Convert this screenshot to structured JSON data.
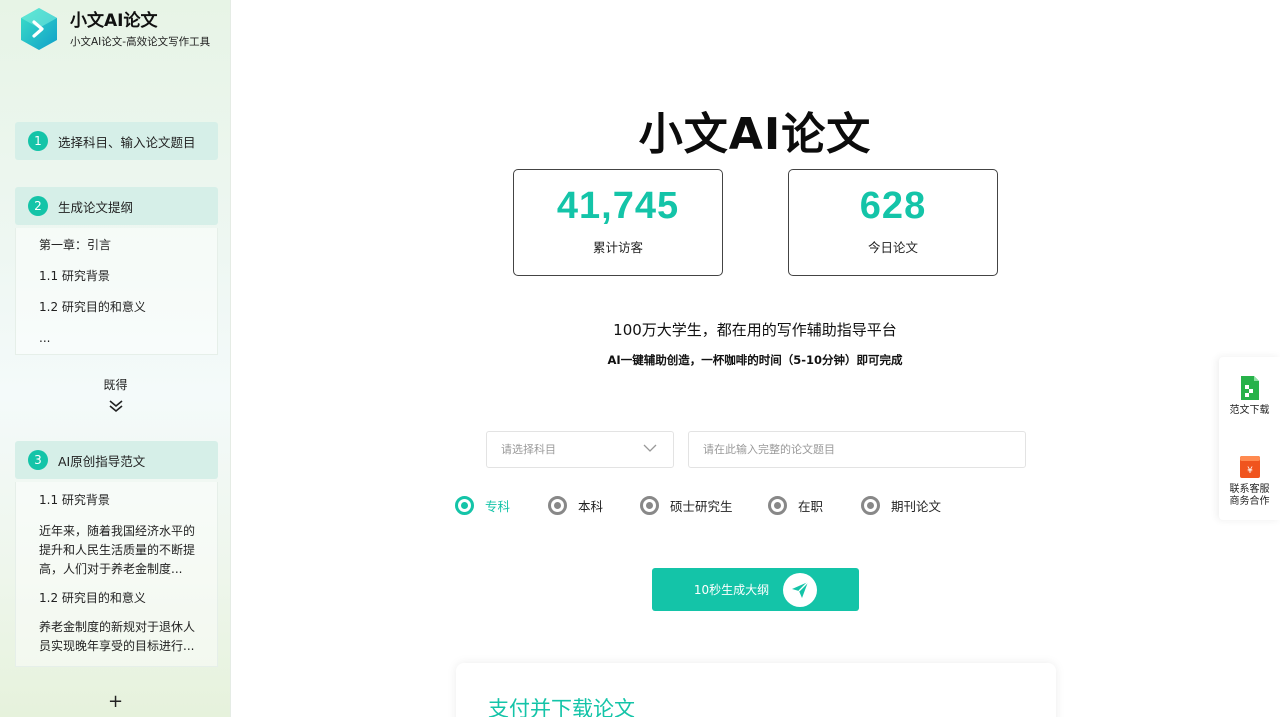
{
  "sidebar": {
    "brand_title": "小文AI论文",
    "brand_subtitle": "小文AI论文-高效论文写作工具",
    "steps": [
      {
        "num": "1",
        "label": "选择科目、输入论文题目"
      },
      {
        "num": "2",
        "label": "生成论文提纲"
      },
      {
        "num": "3",
        "label": "AI原创指导范文"
      }
    ],
    "outline_items": [
      "第一章：引言",
      "1.1 研究背景",
      "1.2 研究目的和意义",
      "..."
    ],
    "collapse_label": "既得",
    "sample": {
      "h1": "1.1 研究背景",
      "p1": "近年来，随着我国经济水平的提升和人民生活质量的不断提高，人们对于养老金制度...",
      "h2": "1.2 研究目的和意义",
      "p2": "养老金制度的新规对于退休人员实现晚年享受的目标进行..."
    },
    "plus": "+"
  },
  "main": {
    "title": "小文AI论文",
    "stats": [
      {
        "value": "41,745",
        "label": "累计访客"
      },
      {
        "value": "628",
        "label": "今日论文"
      }
    ],
    "slogan": "100万大学生，都在用的写作辅助指导平台",
    "slogan2": "AI一键辅助创造，一杯咖啡的时间（5-10分钟）即可完成",
    "subject_placeholder": "请选择科目",
    "topic_placeholder": "请在此输入完整的论文题目",
    "degrees": [
      "专科",
      "本科",
      "硕士研究生",
      "在职",
      "期刊论文"
    ],
    "selected_degree": "专科",
    "generate_label": "10秒生成大纲",
    "pay_title": "支付并下载论文"
  },
  "float_bar": {
    "download_label": "范文下载",
    "contact_line1": "联系客服",
    "contact_line2": "商务合作"
  },
  "colors": {
    "accent": "#14c4a8",
    "step_bg": "#d6efe8",
    "download_icon": "#27b24a",
    "contact_icon": "#f0541e"
  }
}
